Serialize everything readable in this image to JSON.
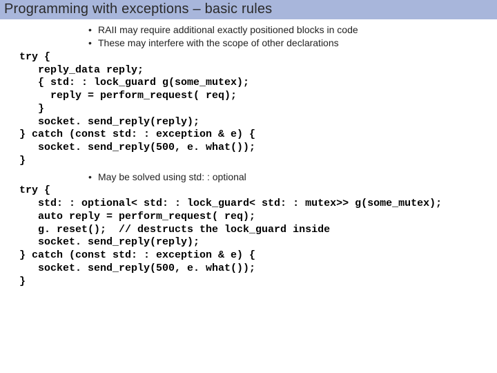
{
  "title": "Programming with exceptions – basic rules",
  "bullets1": [
    "RAII may require additional exactly positioned blocks in code",
    "These may interfere with the scope of other declarations"
  ],
  "code1": "try {\n   reply_data reply;\n   { std: : lock_guard g(some_mutex);\n     reply = perform_request( req);\n   }\n   socket. send_reply(reply);\n} catch (const std: : exception & e) {\n   socket. send_reply(500, e. what());\n}",
  "bullets2": [
    "May be solved using std: : optional"
  ],
  "code2": "try {\n   std: : optional< std: : lock_guard< std: : mutex>> g(some_mutex);\n   auto reply = perform_request( req);\n   g. reset();  // destructs the lock_guard inside\n   socket. send_reply(reply);\n} catch (const std: : exception & e) {\n   socket. send_reply(500, e. what());\n}"
}
